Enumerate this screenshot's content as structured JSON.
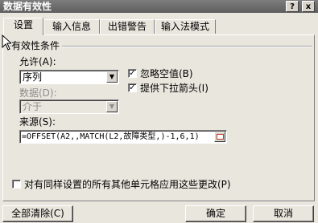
{
  "window": {
    "title": "数据有效性",
    "close_label": "x",
    "help_label": "?"
  },
  "tabs": [
    {
      "label": "设置"
    },
    {
      "label": "输入信息"
    },
    {
      "label": "出错警告"
    },
    {
      "label": "输入法模式"
    }
  ],
  "group": {
    "title": "有效性条件"
  },
  "allow": {
    "label": "允许(A):",
    "value": "序列"
  },
  "data": {
    "label": "数据(D):",
    "value": "介于"
  },
  "ignore_blank": {
    "label": "忽略空值(B)",
    "checked": true
  },
  "dropdown_arrow": {
    "label": "提供下拉箭头(I)",
    "checked": true
  },
  "source": {
    "label": "来源(S):",
    "value": "=OFFSET(A2,,MATCH(L2,故障类型,)-1,6,1)"
  },
  "apply_all": {
    "label": "对有同样设置的所有其他单元格应用这些更改(P)",
    "checked": false
  },
  "buttons": {
    "clear_all": "全部清除(C)",
    "ok": "确定",
    "cancel": "取消"
  },
  "check_glyph": "✓"
}
